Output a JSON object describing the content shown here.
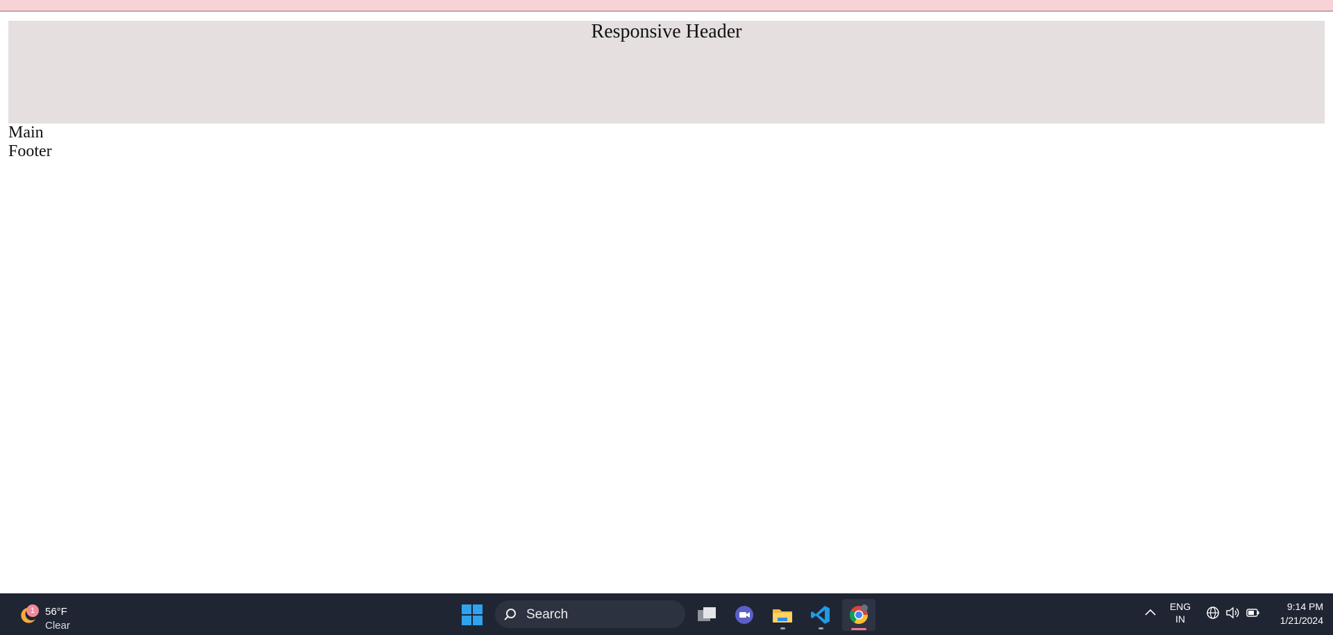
{
  "page": {
    "header_title": "Responsive Header",
    "main_label": "Main",
    "footer_label": "Footer"
  },
  "taskbar": {
    "weather": {
      "badge": "1",
      "temperature": "56°F",
      "condition": "Clear",
      "icon": "moon-icon"
    },
    "search_label": "Search",
    "apps": [
      {
        "name": "task-view",
        "icon": "task-view-icon"
      },
      {
        "name": "meet",
        "icon": "video-chat-icon"
      },
      {
        "name": "file-explorer",
        "icon": "folder-icon"
      },
      {
        "name": "vscode",
        "icon": "vscode-icon"
      },
      {
        "name": "chrome",
        "icon": "chrome-icon",
        "active": true
      }
    ],
    "language": {
      "line1": "ENG",
      "line2": "IN"
    },
    "clock": {
      "time": "9:14 PM",
      "date": "1/21/2024"
    }
  },
  "colors": {
    "top_strip": "#f7d3d6",
    "header_bg": "#e5dfe0",
    "taskbar_bg": "#202533",
    "accent_blue": "#2fa3f0"
  }
}
